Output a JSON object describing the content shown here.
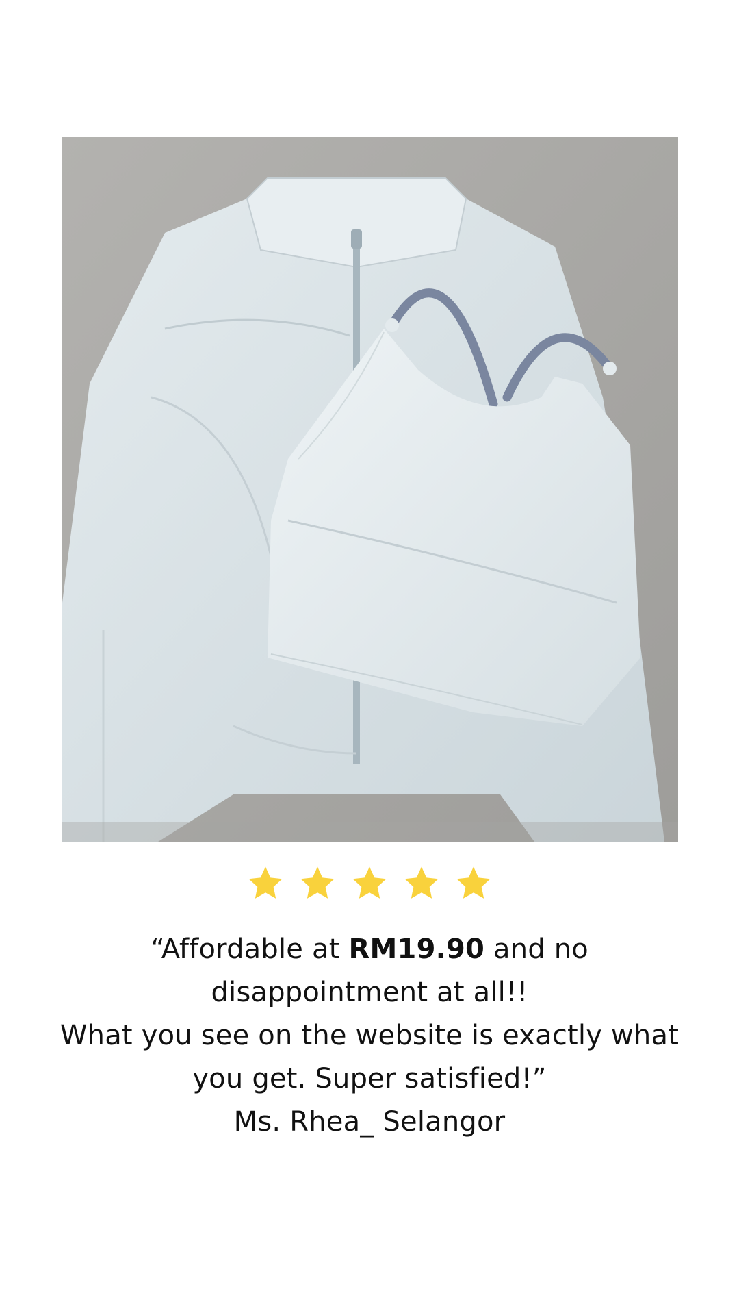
{
  "image": {
    "subject": "product-photo",
    "background_color": "#a9a8a5",
    "garment_color": "#dfe6ea",
    "strap_color": "#7a869f"
  },
  "rating": {
    "stars_filled": 5,
    "stars_total": 5,
    "star_color": "#f9d23c"
  },
  "review": {
    "line1_pre": "“Affordable at ",
    "price": "RM19.90",
    "line1_post": " and no",
    "line2": "disappointment at all!!",
    "line3": "What you see on the website is exactly what",
    "line4": "you get. Super satisfied!”",
    "author": "Ms. Rhea_ Selangor"
  }
}
